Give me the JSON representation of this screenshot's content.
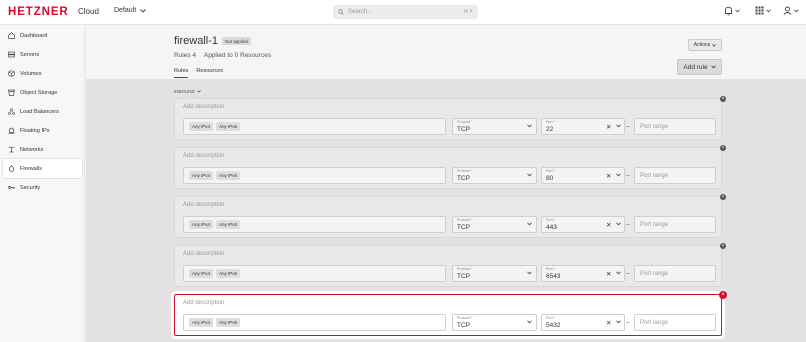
{
  "brand": {
    "logo": "HETZNER",
    "product": "Cloud"
  },
  "project": {
    "name": "Default"
  },
  "search": {
    "placeholder": "Search...",
    "shortcut": "⌘ K"
  },
  "sidebar": {
    "items": [
      {
        "id": "dashboard",
        "label": "Dashboard",
        "icon": "dashboard-icon"
      },
      {
        "id": "servers",
        "label": "Servers",
        "icon": "servers-icon"
      },
      {
        "id": "volumes",
        "label": "Volumes",
        "icon": "volumes-icon"
      },
      {
        "id": "object-storage",
        "label": "Object Storage",
        "icon": "object-storage-icon"
      },
      {
        "id": "load-balancers",
        "label": "Load Balancers",
        "icon": "load-balancer-icon"
      },
      {
        "id": "floating-ips",
        "label": "Floating IPs",
        "icon": "floating-ip-icon"
      },
      {
        "id": "networks",
        "label": "Networks",
        "icon": "network-icon"
      },
      {
        "id": "firewalls",
        "label": "Firewalls",
        "icon": "firewall-icon",
        "active": true
      },
      {
        "id": "security",
        "label": "Security",
        "icon": "key-icon"
      }
    ]
  },
  "page": {
    "title": "firewall-1",
    "badge": "Not applied",
    "rules_count": "Rules 4",
    "applied_to": "Applied to 0 Resources",
    "tabs": [
      {
        "label": "Rules",
        "active": true
      },
      {
        "label": "Resources",
        "active": false
      }
    ],
    "actions_label": "Actions",
    "add_rule_label": "Add rule"
  },
  "inbound": {
    "label": "INBOUND"
  },
  "rules": [
    {
      "description_placeholder": "Add description",
      "sources": [
        "Any IPv4",
        "Any IPv6"
      ],
      "protocol_label": "Protocol *",
      "protocol": "TCP",
      "port_label": "Port *",
      "port": "22",
      "port_range_placeholder": "Port range",
      "focused": false
    },
    {
      "description_placeholder": "Add description",
      "sources": [
        "Any IPv4",
        "Any IPv6"
      ],
      "protocol_label": "Protocol *",
      "protocol": "TCP",
      "port_label": "Port *",
      "port": "80",
      "port_range_placeholder": "Port range",
      "focused": false
    },
    {
      "description_placeholder": "Add description",
      "sources": [
        "Any IPv4",
        "Any IPv6"
      ],
      "protocol_label": "Protocol *",
      "protocol": "TCP",
      "port_label": "Port *",
      "port": "443",
      "port_range_placeholder": "Port range",
      "focused": false
    },
    {
      "description_placeholder": "Add description",
      "sources": [
        "Any IPv4",
        "Any IPv6"
      ],
      "protocol_label": "Protocol *",
      "protocol": "TCP",
      "port_label": "Port *",
      "port": "6543",
      "port_range_placeholder": "Port range",
      "focused": false
    },
    {
      "description_placeholder": "Add description",
      "sources": [
        "Any IPv4",
        "Any IPv6"
      ],
      "protocol_label": "Protocol *",
      "protocol": "TCP",
      "port_label": "Port *",
      "port": "5432",
      "port_range_placeholder": "Port range",
      "focused": true
    }
  ],
  "colors": {
    "brand": "#d50c2d",
    "content_bg": "#e2e2e2"
  }
}
